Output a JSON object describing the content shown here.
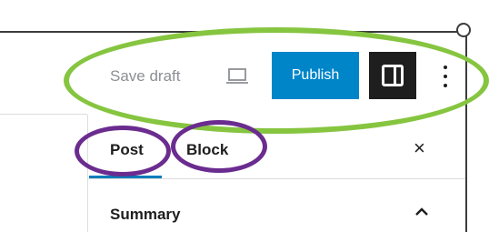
{
  "toolbar": {
    "save_draft_label": "Save draft",
    "preview_icon": "desktop-preview-icon",
    "publish_label": "Publish",
    "settings_icon": "sidebar-panel-icon",
    "more_icon": "vertical-ellipsis-icon"
  },
  "sidebar": {
    "tabs": [
      {
        "label": "Post",
        "active": true
      },
      {
        "label": "Block",
        "active": false
      }
    ],
    "close_label": "×",
    "panels": [
      {
        "label": "Summary",
        "expanded": true
      }
    ]
  },
  "annotations": {
    "toolbar_highlight_color": "#86c540",
    "tab_highlight_color": "#6b2c8f"
  },
  "colors": {
    "publish_bg": "#0085c9",
    "settings_bg": "#1e1e1e",
    "active_tab_indicator": "#007cba"
  }
}
